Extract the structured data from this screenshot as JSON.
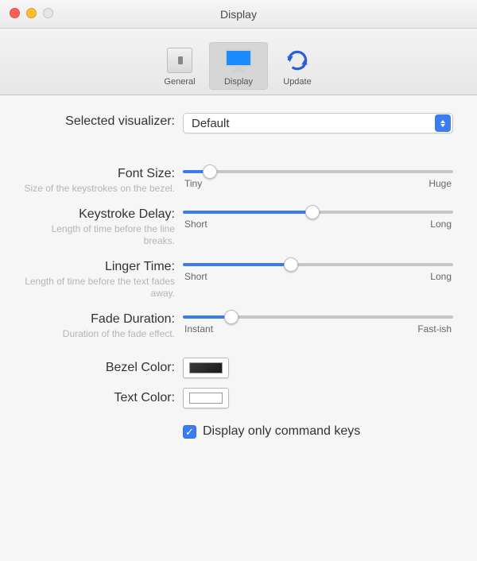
{
  "window": {
    "title": "Display"
  },
  "toolbar": {
    "items": [
      {
        "label": "General"
      },
      {
        "label": "Display"
      },
      {
        "label": "Update"
      }
    ]
  },
  "visualizer": {
    "label": "Selected visualizer:",
    "value": "Default"
  },
  "sliders": {
    "fontSize": {
      "label": "Font Size:",
      "hint": "Size of the keystrokes on the bezel.",
      "min": "Tiny",
      "max": "Huge",
      "pct": 10
    },
    "keystroke": {
      "label": "Keystroke Delay:",
      "hint": "Length of time before the line breaks.",
      "min": "Short",
      "max": "Long",
      "pct": 48
    },
    "linger": {
      "label": "Linger Time:",
      "hint": "Length of time before the text fades away.",
      "min": "Short",
      "max": "Long",
      "pct": 40
    },
    "fade": {
      "label": "Fade Duration:",
      "hint": "Duration of the fade effect.",
      "min": "Instant",
      "max": "Fast-ish",
      "pct": 18
    }
  },
  "colors": {
    "bezel": {
      "label": "Bezel Color:",
      "value": "#1a1a1a"
    },
    "text": {
      "label": "Text Color:",
      "value": "#ffffff"
    }
  },
  "checkbox": {
    "label": "Display only command keys",
    "checked": true
  }
}
